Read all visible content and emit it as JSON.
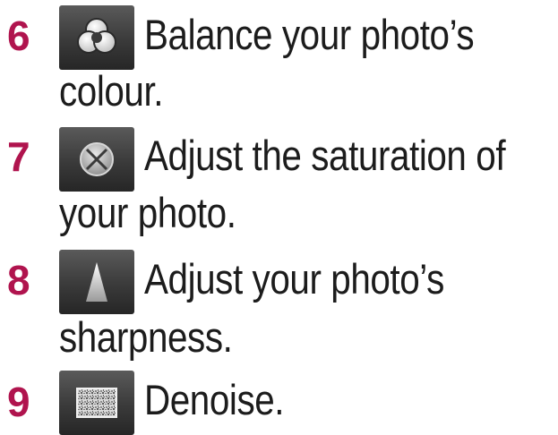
{
  "items": [
    {
      "number": "6",
      "icon": "colour-balance-icon",
      "line1": "Balance your photo’s",
      "line2": "colour."
    },
    {
      "number": "7",
      "icon": "saturation-icon",
      "line1": "Adjust the saturation of",
      "line2": "your photo."
    },
    {
      "number": "8",
      "icon": "sharpness-icon",
      "line1": "Adjust your photo’s",
      "line2": "sharpness."
    },
    {
      "number": "9",
      "icon": "denoise-icon",
      "line1": "Denoise.",
      "line2": ""
    }
  ],
  "colors": {
    "number": "#b0144e",
    "text": "#1c1c1c",
    "icon_background": "#3a3a3a"
  }
}
